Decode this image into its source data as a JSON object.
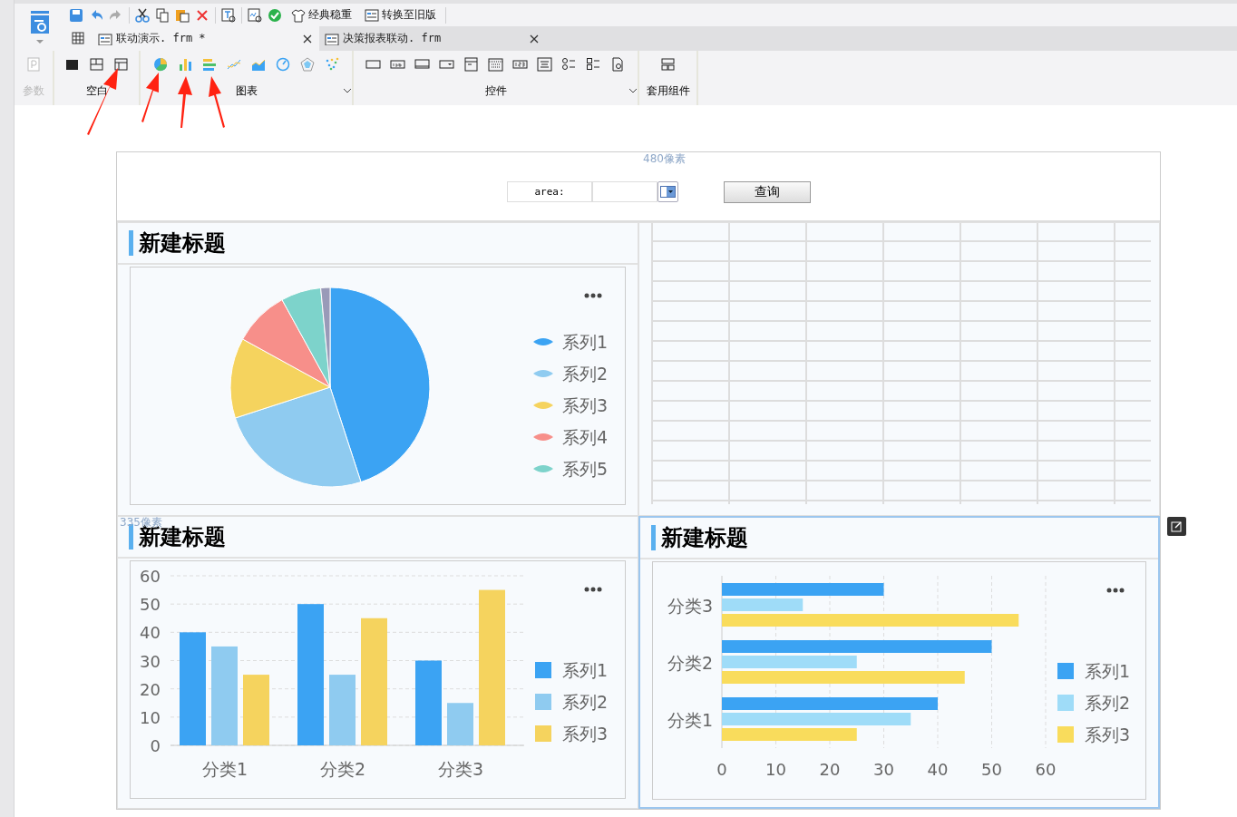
{
  "toolbar": {
    "items": [
      {
        "label": "经典稳重"
      },
      {
        "label": "转换至旧版"
      }
    ]
  },
  "tabs": [
    {
      "label": "联动演示. frm *",
      "selected": true
    },
    {
      "label": "决策报表联动. frm",
      "selected": false
    }
  ],
  "ribbon": {
    "groups": [
      {
        "label": "参数",
        "disabled": true
      },
      {
        "label": "空白",
        "disabled": false
      },
      {
        "label": "图表",
        "disabled": false
      },
      {
        "label": "控件",
        "disabled": false
      },
      {
        "label": "套用组件",
        "disabled": false
      }
    ]
  },
  "canvas": {
    "width_hint": "480像素",
    "height_hint": "335像素"
  },
  "query": {
    "label": "area:",
    "button": "查询"
  },
  "widgets": [
    {
      "kind": "pie",
      "title": "新建标题",
      "selected": false,
      "legend": [
        {
          "label": "系列1",
          "color": "#3ba3f3"
        },
        {
          "label": "系列2",
          "color": "#8fcbf0"
        },
        {
          "label": "系列3",
          "color": "#f5d35e"
        },
        {
          "label": "系列4",
          "color": "#f78f8a"
        },
        {
          "label": "系列5",
          "color": "#7dd3cb"
        }
      ]
    },
    {
      "kind": "table",
      "selected": false
    },
    {
      "kind": "column",
      "title": "新建标题",
      "selected": false,
      "chart_data": {
        "type": "bar",
        "orientation": "vertical",
        "categories": [
          "分类1",
          "分类2",
          "分类3"
        ],
        "series": [
          {
            "name": "系列1",
            "color": "#3ba3f3",
            "values": [
              40,
              50,
              30
            ]
          },
          {
            "name": "系列2",
            "color": "#8fcbf0",
            "values": [
              35,
              25,
              15
            ]
          },
          {
            "name": "系列3",
            "color": "#f5d35e",
            "values": [
              25,
              45,
              55
            ]
          }
        ],
        "ylim": [
          0,
          60
        ],
        "yticks": [
          0,
          10,
          20,
          30,
          40,
          50,
          60
        ],
        "grid": true,
        "legend": true
      }
    },
    {
      "kind": "bar",
      "title": "新建标题",
      "selected": true,
      "chart_data": {
        "type": "bar",
        "orientation": "horizontal",
        "categories": [
          "分类3",
          "分类2",
          "分类1"
        ],
        "series": [
          {
            "name": "系列1",
            "color": "#3ba3f3",
            "values": [
              30,
              50,
              40
            ]
          },
          {
            "name": "系列2",
            "color": "#9fdcf8",
            "values": [
              15,
              25,
              35
            ]
          },
          {
            "name": "系列3",
            "color": "#f9dc5c",
            "values": [
              55,
              45,
              25
            ]
          }
        ],
        "xlim": [
          0,
          60
        ],
        "xticks": [
          0,
          10,
          20,
          30,
          40,
          50,
          60
        ],
        "grid": true,
        "legend": true
      }
    }
  ]
}
